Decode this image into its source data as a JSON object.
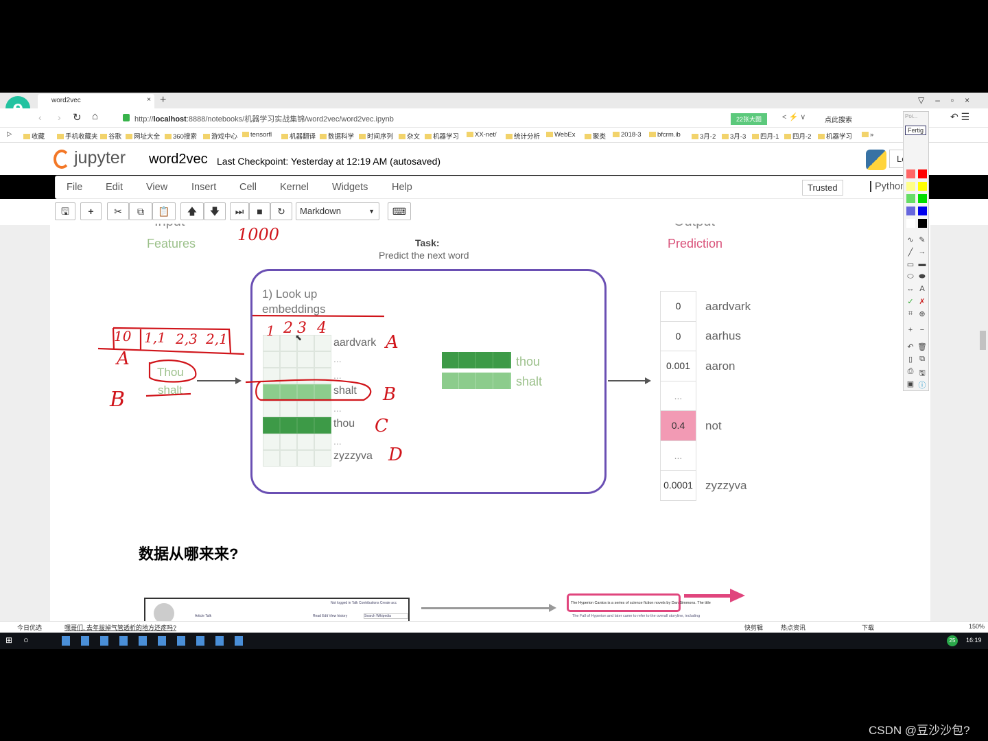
{
  "browser": {
    "tab_title": "word2vec",
    "url_prefix": "http://",
    "url_host": "localhost",
    "url_rest": ":8888/notebooks/机器学习实战集锦/word2vec/word2vec.ipynb",
    "green_badge": "22张大图",
    "search_placeholder": "点此搜索",
    "bookmarks": [
      "收藏",
      "手机收藏夹",
      "谷歌",
      "网址大全",
      "360搜索",
      "游戏中心",
      "tensorfl",
      "机器翻译",
      "数据科学",
      "时间序列",
      "杂文",
      "机器学习",
      "XX-net/",
      "统计分析",
      "WebEx",
      "聚类",
      "2018-3",
      "bfcrm.ib",
      "3月-2",
      "3月-3",
      "四月-1",
      "四月-2",
      "机器学习",
      "»"
    ]
  },
  "jupyter": {
    "logo": "jupyter",
    "notebook_name": "word2vec",
    "checkpoint": "Last Checkpoint: Yesterday at 12:19 AM (autosaved)",
    "logout": "Lo",
    "menu": [
      "File",
      "Edit",
      "View",
      "Insert",
      "Cell",
      "Kernel",
      "Widgets",
      "Help"
    ],
    "trusted": "Trusted",
    "kernel": "Python",
    "cell_type": "Markdown"
  },
  "diagram": {
    "input_label": "Input",
    "features": "Features",
    "task_title": "Task:",
    "task_desc": "Predict the next word",
    "output_label": "Output",
    "prediction": "Prediction",
    "lookup": "1) Look up embeddings",
    "inputs": [
      "Thou",
      "shalt"
    ],
    "vocab": [
      "aardvark",
      "...",
      "...",
      "shalt",
      "...",
      "thou",
      "...",
      "zyzzyva"
    ],
    "mid_words": [
      "thou",
      "shalt"
    ],
    "output_values": [
      "0",
      "0",
      "0.001",
      "...",
      "0.4",
      "...",
      "0.0001"
    ],
    "output_words": [
      "aardvark",
      "aarhus",
      "aaron",
      "",
      "not",
      "",
      "zyzzyva"
    ],
    "colors": {
      "dark_green": "#3d9a47",
      "light_green": "#8ccc8c",
      "highlight": "#f29ab4",
      "box": "#6a4fb3",
      "annotation": "#d0141a"
    }
  },
  "annotations": {
    "top": "1000",
    "row": [
      "10",
      "1,1",
      "2,3",
      "2,1"
    ],
    "cols": [
      "1",
      "2",
      "3",
      "4"
    ],
    "A": "A",
    "B": "B",
    "right": [
      "A",
      "B",
      "C",
      "D"
    ]
  },
  "section_heading": "数据从哪来来?",
  "bottom_preview": {
    "wiki_links": "Not logged in  Talk  Contributions  Create acc",
    "wiki_tabs": "Article  Talk",
    "wiki_actions": "Read  Edit  View history",
    "wiki_search": "Search Wikipedia",
    "text1": "The Hyperion Cantos is a series of science fiction novels by Dan Simmons. The title",
    "text2": "The Fall of Hyperion and later came to refer to the overall storyline, including"
  },
  "statusbar": {
    "left1": "今日优选",
    "left2": "嘿哥们, 去年拔掉气管透析的地方还疼吗?",
    "right": [
      "快剪辑",
      "热点资讯",
      "下载"
    ],
    "zoom": "150%"
  },
  "taskbar": {
    "time": "16:19",
    "badge": "25"
  },
  "pen_toolbar": {
    "top": "Poi...",
    "done": "Fertig"
  },
  "watermark": "CSDN @豆沙沙包?"
}
